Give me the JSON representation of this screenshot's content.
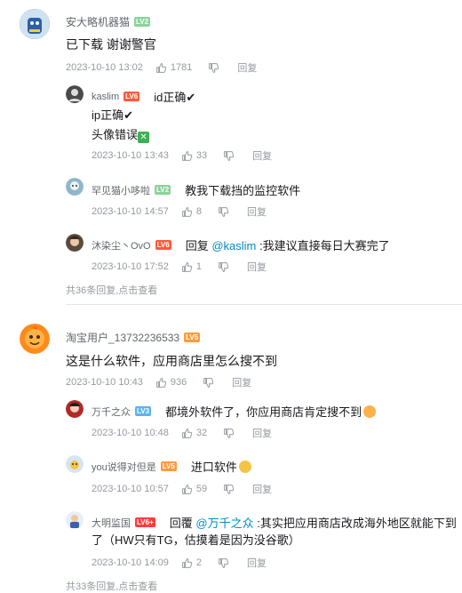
{
  "comments": [
    {
      "user": "安大略机器猫",
      "level": "LV2",
      "content": "已下载 谢谢警官",
      "time": "2023-10-10 13:02",
      "likes": "1781",
      "reply_label": "回复",
      "replies": [
        {
          "user": "kaslim",
          "level": "LV6",
          "line1": "id正确✔",
          "line2": "ip正确✔",
          "line3": "头像错误",
          "time": "2023-10-10 13:43",
          "likes": "33",
          "reply_label": "回复"
        },
        {
          "user": "罕见猫小哆啦",
          "level": "LV2",
          "content": "教我下载挡的监控软件",
          "time": "2023-10-10 14:57",
          "likes": "8",
          "reply_label": "回复"
        },
        {
          "user": "沐染尘丶OvO",
          "level": "LV6",
          "prefix": "回复",
          "at": "@kaslim",
          "content": " :我建议直接每日大赛完了",
          "time": "2023-10-10 17:52",
          "likes": "1",
          "reply_label": "回复"
        }
      ],
      "more_count": "共36条回复,",
      "more_link": "点击查看"
    },
    {
      "user": "淘宝用户_13732236533",
      "level": "LV5",
      "content": "这是什么软件，应用商店里怎么搜不到",
      "time": "2023-10-10 10:43",
      "likes": "936",
      "reply_label": "回复",
      "replies": [
        {
          "user": "万千之众",
          "level": "LV3",
          "content": "都境外软件了，你应用商店肯定搜不到",
          "time": "2023-10-10 10:48",
          "likes": "32",
          "reply_label": "回复"
        },
        {
          "user": "you说得对但是",
          "level": "LV5",
          "content": "进口软件",
          "time": "2023-10-10 10:57",
          "likes": "59",
          "reply_label": "回复"
        },
        {
          "user": "大明监国",
          "level": "LV6+",
          "prefix": "回覆",
          "at": "@万千之众",
          "content": " :其实把应用商店改成海外地区就能下到",
          "content2": "了（HW只有TG，估摸着是因为没谷歌）",
          "time": "2023-10-10 14:09",
          "likes": "2",
          "reply_label": "回复"
        }
      ],
      "more_count": "共33条回复,",
      "more_link": "点击查看"
    }
  ],
  "colors": {
    "link": "#008ac5",
    "meta": "#9499a0",
    "lv2": "#8bd29b",
    "lv5": "#ff9a3c",
    "lv6": "#ff5a3c"
  },
  "icons": [
    "thumbs-up-icon",
    "thumbs-down-icon",
    "check-icon",
    "cross-mark-icon",
    "avatar"
  ]
}
